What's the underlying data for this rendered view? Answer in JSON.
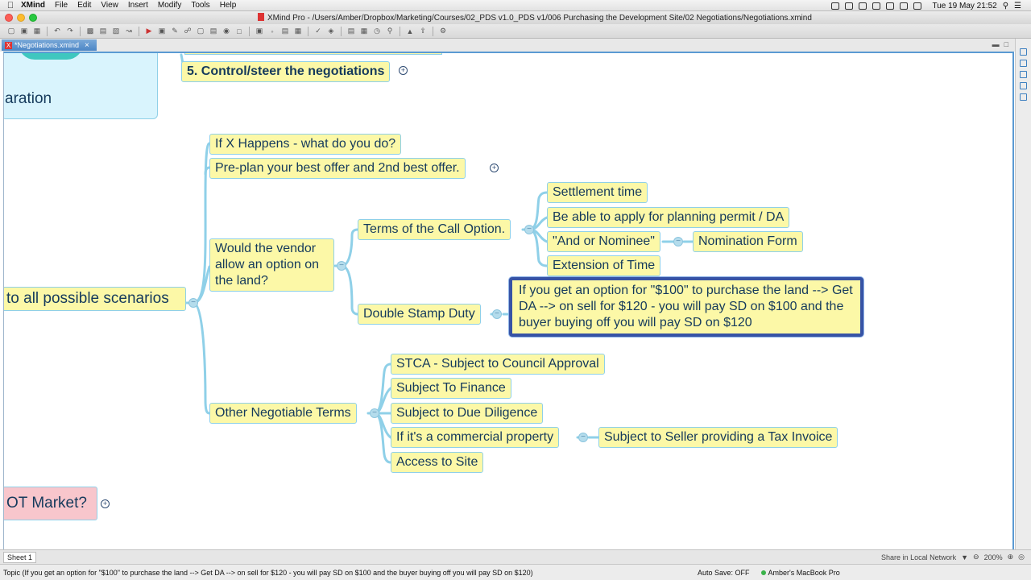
{
  "menubar": {
    "app": "XMind",
    "items": [
      "File",
      "Edit",
      "View",
      "Insert",
      "Modify",
      "Tools",
      "Help"
    ],
    "clock": "Tue 19 May  21:52"
  },
  "window": {
    "title": "XMind Pro - /Users/Amber/Dropbox/Marketing/Courses/02_PDS v1.0_PDS v1/006 Purchasing the Development Site/02 Negotiations/Negotiations.xmind"
  },
  "tab": {
    "label": "*Negotiations.xmind"
  },
  "map": {
    "steer": "5. Control/steer the negotiations",
    "preparation": "aration",
    "scenarios": "to all possible scenarios",
    "if_x": "If X Happens - what do you do?",
    "preplan": "Pre-plan your best offer and 2nd best offer.",
    "vendor": "Would the vendor allow an option on the land?",
    "call_terms": "Terms of the Call Option.",
    "settlement": "Settlement time",
    "planning": "Be able to apply for planning permit / DA",
    "nominee": "\"And or Nominee\"",
    "nomination_form": "Nomination Form",
    "extension": "Extension of Time",
    "double_stamp": "Double Stamp Duty",
    "option_note": "If you get an option for \"$100\" to purchase the land --> Get DA --> on sell for $120 - you will pay SD on $100 and the buyer buying off you will pay SD on $120",
    "other_terms": "Other Negotiable Terms",
    "stca": "STCA - Subject to Council Approval",
    "finance": "Subject To Finance",
    "diligence": "Subject to Due Diligence",
    "commercial": "If it's a commercial property",
    "tax_invoice": "Subject to Seller providing a Tax Invoice",
    "access": "Access to Site",
    "market": "OT Market?"
  },
  "sheet": {
    "tab": "Sheet 1",
    "share": "Share in Local Network",
    "zoom": "200%"
  },
  "status": {
    "message": "Topic (If you get an option for \"$100\" to purchase the land --> Get DA --> on sell for $120 - you will pay SD on $100 and the buyer buying off you will pay SD on $120)",
    "autosave": "Auto Save: OFF",
    "machine": "Amber's MacBook Pro"
  },
  "colors": {
    "topic_fill": "#fcf8a7",
    "topic_border": "#8fd0e8",
    "connector": "#8fd0e8",
    "selection": "#3753a5",
    "market_fill": "#f8c6cc"
  }
}
